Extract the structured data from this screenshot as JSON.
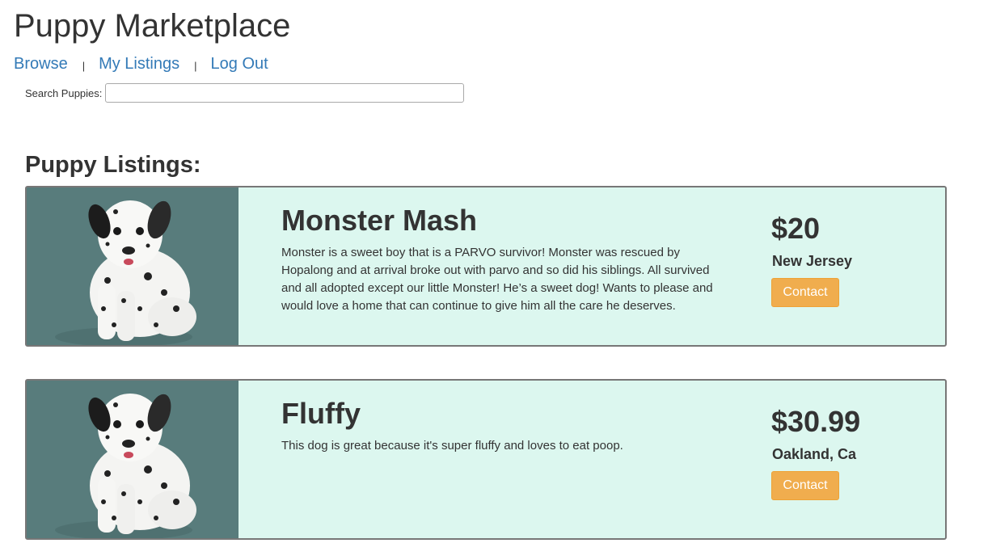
{
  "header": {
    "title": "Puppy Marketplace",
    "nav": [
      {
        "label": "Browse"
      },
      {
        "label": "My Listings"
      },
      {
        "label": "Log Out"
      }
    ],
    "separator": "|"
  },
  "search": {
    "label": "Search Puppies:",
    "value": "",
    "placeholder": ""
  },
  "listings_section": {
    "heading": "Puppy Listings:",
    "items": [
      {
        "title": "Monster Mash",
        "description": "Monster is a sweet boy that is a PARVO survivor! Monster was rescued by Hopalong and at arrival broke out with parvo and so did his siblings. All survived and all adopted except our little Monster! He’s a sweet dog! Wants to please and would love a home that can continue to give him all the care he deserves.",
        "price": "$20",
        "location": "New Jersey",
        "contact_label": "Contact",
        "image_icon": "dalmatian-puppy-photo"
      },
      {
        "title": "Fluffy",
        "description": "This dog is great because it's super fluffy and loves to eat poop.",
        "price": "$30.99",
        "location": "Oakland, Ca",
        "contact_label": "Contact",
        "image_icon": "dalmatian-puppy-photo"
      }
    ]
  },
  "colors": {
    "link": "#337ab7",
    "listing_background": "#dcf7ef",
    "listing_border": "#777777",
    "contact_button": "#f0ad4e",
    "text": "#333333"
  }
}
